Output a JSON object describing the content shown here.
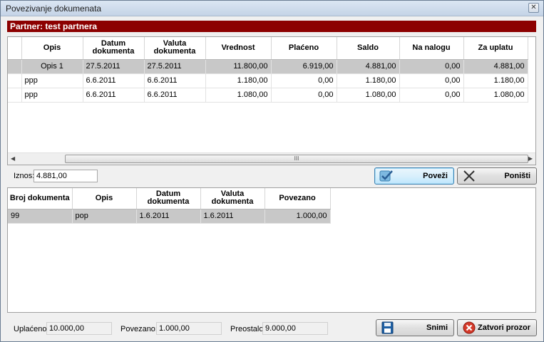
{
  "window": {
    "title": "Povezivanje dokumenata",
    "close_glyph": "✕"
  },
  "partner": {
    "label": "Partner: test partnera"
  },
  "top_grid": {
    "columns": [
      "Opis",
      "Datum dokumenta",
      "Valuta dokumenta",
      "Vrednost",
      "Plaćeno",
      "Saldo",
      "Na nalogu",
      "Za uplatu"
    ],
    "rows": [
      [
        "Opis 1",
        "27.5.2011",
        "27.5.2011",
        "11.800,00",
        "6.919,00",
        "4.881,00",
        "0,00",
        "4.881,00"
      ],
      [
        "ppp",
        "6.6.2011",
        "6.6.2011",
        "1.180,00",
        "0,00",
        "1.180,00",
        "0,00",
        "1.180,00"
      ],
      [
        "ppp",
        "6.6.2011",
        "6.6.2011",
        "1.080,00",
        "0,00",
        "1.080,00",
        "0,00",
        "1.080,00"
      ]
    ],
    "scroll_grip": "III"
  },
  "iznos": {
    "label": "Iznos:",
    "value": "4.881,00"
  },
  "buttons": {
    "povezi": "Poveži",
    "ponisti": "Poništi",
    "snimi": "Snimi",
    "zatvori": "Zatvori prozor"
  },
  "bottom_grid": {
    "columns": [
      "Broj dokumenta",
      "Opis",
      "Datum dokumenta",
      "Valuta dokumenta",
      "Povezano"
    ],
    "rows": [
      [
        "99",
        "pop",
        "1.6.2011",
        "1.6.2011",
        "1.000,00"
      ]
    ]
  },
  "footer": {
    "uplaceno_label": "Uplaćeno:",
    "uplaceno_value": "10.000,00",
    "povezano_label": "Povezano:",
    "povezano_value": "1.000,00",
    "preostalo_label": "Preostalo:",
    "preostalo_value": "9.000,00"
  },
  "icons": {
    "povezi": "checkmark-icon",
    "ponisti": "x-icon",
    "snimi": "save-icon",
    "zatvori": "close-circle-icon"
  }
}
